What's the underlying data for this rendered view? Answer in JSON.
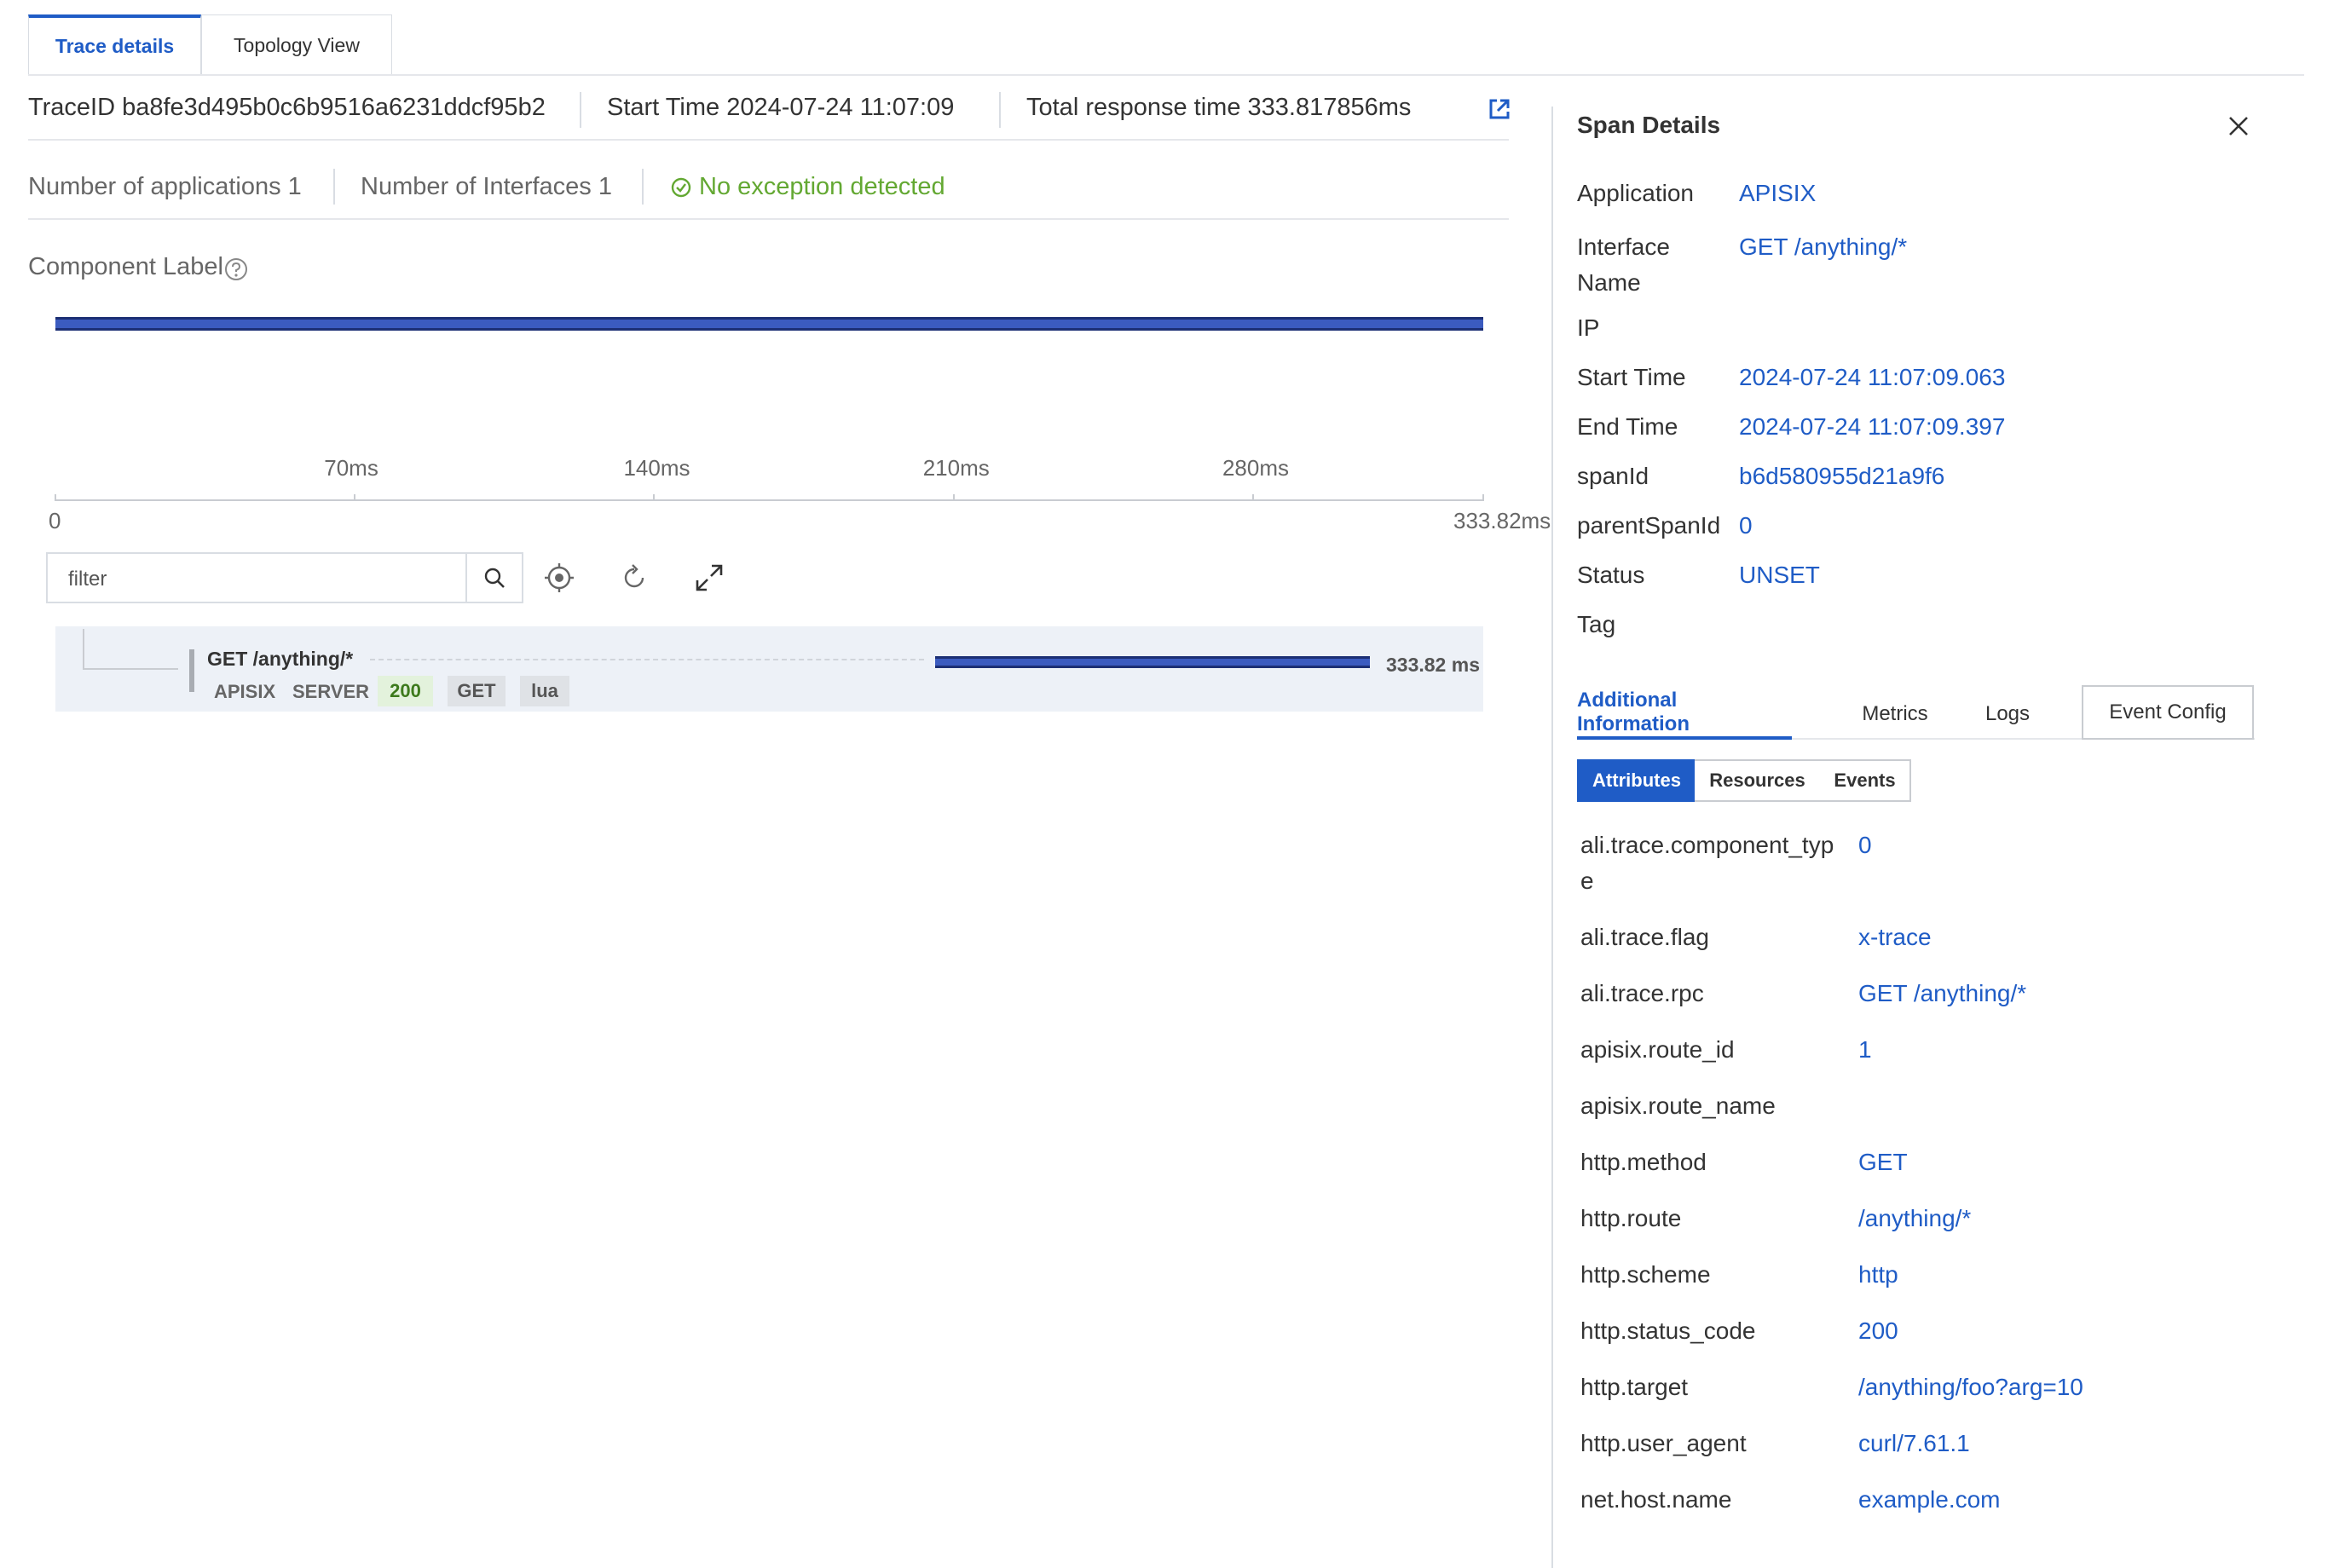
{
  "tabs": [
    {
      "label": "Trace details"
    },
    {
      "label": "Topology View"
    }
  ],
  "summary": {
    "trace_id": "TraceID ba8fe3d495b0c6b9516a6231ddcf95b2",
    "start_time": "Start Time 2024-07-24 11:07:09",
    "total_response_time": "Total response time 333.817856ms",
    "num_applications": "Number of applications 1",
    "num_interfaces": "Number of Interfaces 1",
    "exception_status": "No exception detected"
  },
  "component_label": "Component Label",
  "timeline": {
    "origin_label": "0",
    "end_label": "333.82ms",
    "ticks": [
      "70ms",
      "140ms",
      "210ms",
      "280ms"
    ],
    "total_ms": 333.82,
    "bar_color": "#3b5bbf"
  },
  "filter": {
    "placeholder": "filter"
  },
  "span": {
    "name": "GET /anything/*",
    "duration": "333.82 ms",
    "application": "APISIX",
    "kind": "SERVER",
    "tags": [
      "200",
      "GET",
      "lua"
    ]
  },
  "span_details": {
    "title": "Span Details",
    "fields": [
      {
        "label": "Application",
        "value": "APISIX"
      },
      {
        "label": "Interface Name",
        "value": "GET /anything/*"
      },
      {
        "label": "IP",
        "value": ""
      },
      {
        "label": "Start Time",
        "value": "2024-07-24 11:07:09.063"
      },
      {
        "label": "End Time",
        "value": "2024-07-24 11:07:09.397"
      },
      {
        "label": "spanId",
        "value": "b6d580955d21a9f6"
      },
      {
        "label": "parentSpanId",
        "value": "0"
      },
      {
        "label": "Status",
        "value": "UNSET"
      },
      {
        "label": "Tag",
        "value": ""
      }
    ],
    "info_tabs": [
      "Additional Information",
      "Metrics",
      "Logs"
    ],
    "event_config_label": "Event Config",
    "segments": [
      "Attributes",
      "Resources",
      "Events"
    ],
    "attributes": [
      {
        "key": "ali.trace.component_type",
        "value": "0"
      },
      {
        "key": "ali.trace.flag",
        "value": "x-trace"
      },
      {
        "key": "ali.trace.rpc",
        "value": "GET /anything/*"
      },
      {
        "key": "apisix.route_id",
        "value": "1"
      },
      {
        "key": "apisix.route_name",
        "value": ""
      },
      {
        "key": "http.method",
        "value": "GET"
      },
      {
        "key": "http.route",
        "value": "/anything/*"
      },
      {
        "key": "http.scheme",
        "value": "http"
      },
      {
        "key": "http.status_code",
        "value": "200"
      },
      {
        "key": "http.target",
        "value": "/anything/foo?arg=10"
      },
      {
        "key": "http.user_agent",
        "value": "curl/7.61.1"
      },
      {
        "key": "net.host.name",
        "value": "example.com"
      }
    ]
  },
  "colors": {
    "accent": "#1f5cc6",
    "success": "#63a832",
    "bar": "#3b5bbf"
  }
}
